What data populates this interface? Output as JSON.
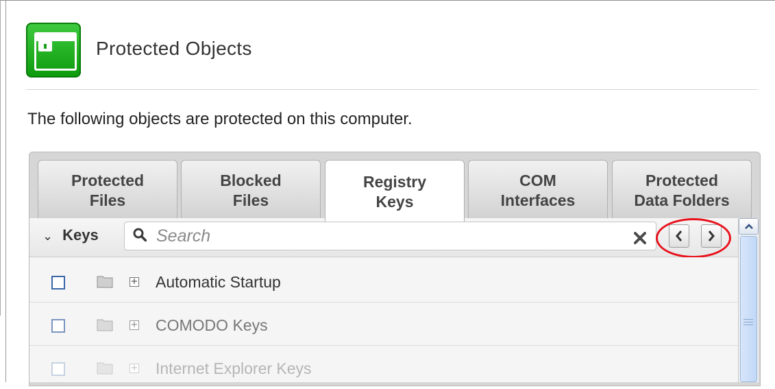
{
  "header": {
    "title": "Protected Objects"
  },
  "description": "The following objects are protected on this computer.",
  "tabs": [
    {
      "label": "Protected\nFiles",
      "active": false
    },
    {
      "label": "Blocked\nFiles",
      "active": false
    },
    {
      "label": "Registry\nKeys",
      "active": true
    },
    {
      "label": "COM\nInterfaces",
      "active": false
    },
    {
      "label": "Protected\nData Folders",
      "active": false
    }
  ],
  "toolbar": {
    "group_label": "Keys",
    "search_placeholder": "Search",
    "icons": {
      "collapse": "chevron-down-icon",
      "search": "search-icon",
      "clear": "clear-icon",
      "prev": "chevron-left-icon",
      "next": "chevron-right-icon"
    },
    "highlight_color": "#e8111b"
  },
  "rows": [
    {
      "label": "Automatic Startup",
      "checked": false
    },
    {
      "label": "COMODO Keys",
      "checked": false
    },
    {
      "label": "Internet Explorer Keys",
      "checked": false
    }
  ],
  "colors": {
    "brand_green": "#1aa01a",
    "checkbox_blue": "#3a67a8",
    "scroll_blue": "#c1d8f6"
  }
}
